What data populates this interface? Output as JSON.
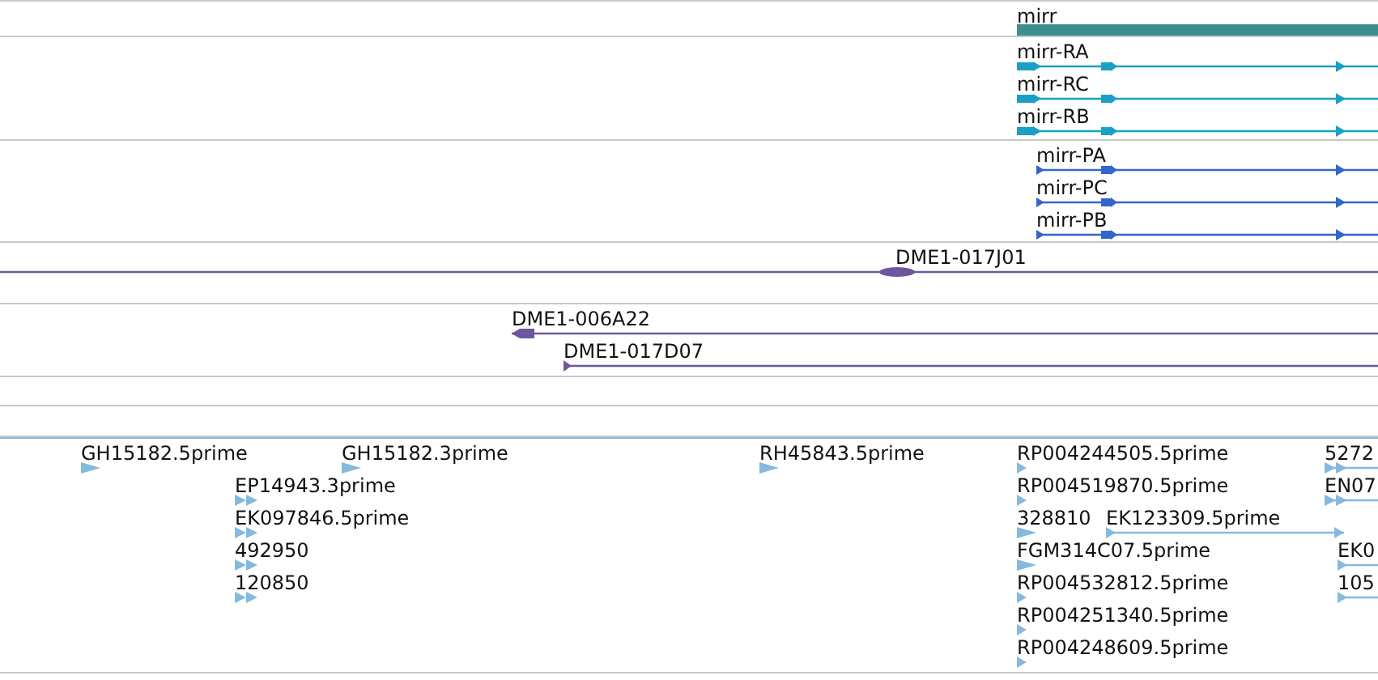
{
  "tracks": [
    {
      "kind": "gene",
      "features": [
        {
          "label": "mirr"
        }
      ]
    },
    {
      "kind": "transcript",
      "features": [
        {
          "label": "mirr-RA"
        },
        {
          "label": "mirr-RC"
        },
        {
          "label": "mirr-RB"
        }
      ]
    },
    {
      "kind": "protein",
      "features": [
        {
          "label": "mirr-PA"
        },
        {
          "label": "mirr-PC"
        },
        {
          "label": "mirr-PB"
        }
      ]
    },
    {
      "kind": "clone",
      "features": [
        {
          "label": "DME1-017J01"
        }
      ]
    },
    {
      "kind": "clone",
      "features": [
        {
          "label": "DME1-006A22"
        },
        {
          "label": "DME1-017D07"
        }
      ]
    },
    {
      "kind": "empty"
    },
    {
      "kind": "empty"
    },
    {
      "kind": "est",
      "features": [
        {
          "label": "GH15182.5prime"
        },
        {
          "label": "GH15182.3prime"
        },
        {
          "label": "EP14943.3prime"
        },
        {
          "label": "EK097846.5prime"
        },
        {
          "label": "492950"
        },
        {
          "label": "120850"
        },
        {
          "label": "RH45843.5prime"
        },
        {
          "label": "RP004244505.5prime"
        },
        {
          "label": "RP004519870.5prime"
        },
        {
          "label": "328810"
        },
        {
          "label": "EK123309.5prime"
        },
        {
          "label": "FGM314C07.5prime"
        },
        {
          "label": "RP004532812.5prime"
        },
        {
          "label": "RP004251340.5prime"
        },
        {
          "label": "RP004248609.5prime"
        },
        {
          "label": "5272"
        },
        {
          "label": "EN07"
        },
        {
          "label": "EK0"
        },
        {
          "label": "105"
        }
      ]
    }
  ]
}
